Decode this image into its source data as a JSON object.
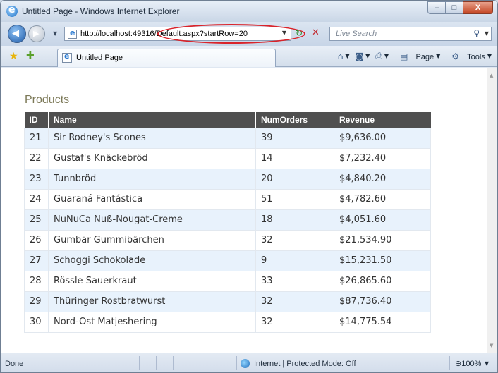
{
  "window": {
    "title": "Untitled Page - Windows Internet Explorer",
    "minimize_label": "–",
    "maximize_label": "□",
    "close_label": "X"
  },
  "address_bar": {
    "url": "http://localhost:49316/Default.aspx?startRow=20",
    "search_placeholder": "Live Search"
  },
  "tab": {
    "label": "Untitled Page"
  },
  "commands": {
    "page_label": "Page",
    "tools_label": "Tools"
  },
  "content": {
    "heading": "Products",
    "table": {
      "columns": [
        "ID",
        "Name",
        "NumOrders",
        "Revenue"
      ],
      "rows": [
        [
          "21",
          "Sir Rodney's Scones",
          "39",
          "$9,636.00"
        ],
        [
          "22",
          "Gustaf's Knäckebröd",
          "14",
          "$7,232.40"
        ],
        [
          "23",
          "Tunnbröd",
          "20",
          "$4,840.20"
        ],
        [
          "24",
          "Guaraná Fantástica",
          "51",
          "$4,782.60"
        ],
        [
          "25",
          "NuNuCa Nuß-Nougat-Creme",
          "18",
          "$4,051.60"
        ],
        [
          "26",
          "Gumbär Gummibärchen",
          "32",
          "$21,534.90"
        ],
        [
          "27",
          "Schoggi Schokolade",
          "9",
          "$15,231.50"
        ],
        [
          "28",
          "Rössle Sauerkraut",
          "33",
          "$26,865.60"
        ],
        [
          "29",
          "Thüringer Rostbratwurst",
          "32",
          "$87,736.40"
        ],
        [
          "30",
          "Nord-Ost Matjeshering",
          "32",
          "$14,775.54"
        ]
      ]
    }
  },
  "status_bar": {
    "status": "Done",
    "zone": "Internet | Protected Mode: Off",
    "zoom": "100%"
  },
  "colors": {
    "header_bg": "#4f4f4f",
    "row_alt_bg": "#e8f2fc",
    "heading_color": "#7c7958",
    "annotation_ellipse": "#d9232a"
  }
}
